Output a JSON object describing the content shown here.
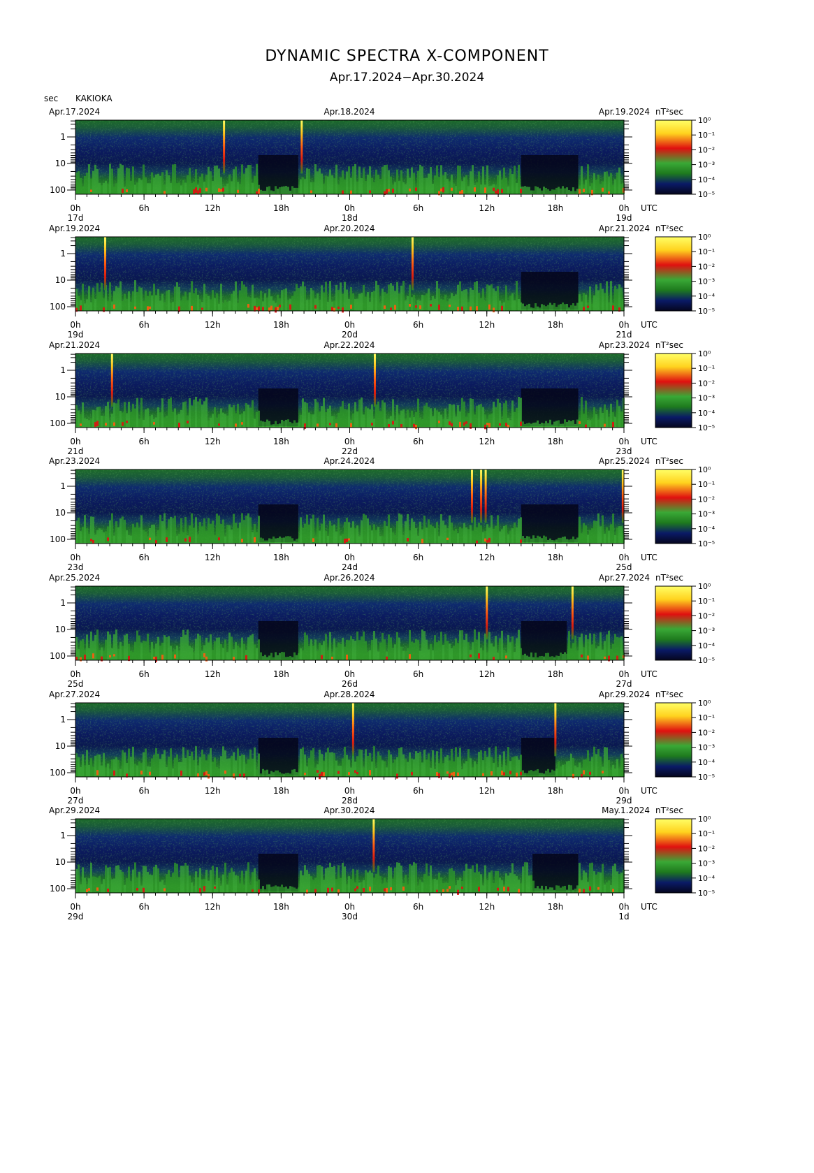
{
  "title": "DYNAMIC SPECTRA X-COMPONENT",
  "subtitle": "Apr.17.2024−Apr.30.2024",
  "period_label": "sec",
  "station": "KAKIOKA",
  "colors": {
    "scale": [
      "#05061e",
      "#0a1a66",
      "#1e7a1e",
      "#3aa836",
      "#e01010",
      "#ff5a10",
      "#ffd21e",
      "#ffff66"
    ]
  },
  "chart_data": {
    "type": "heatmap",
    "y_label": "sec",
    "y_scale": "log",
    "y_ticks": [
      "1",
      "10",
      "100"
    ],
    "x_ticks": [
      "0h",
      "6h",
      "12h",
      "18h",
      "0h",
      "6h",
      "12h",
      "18h",
      "0h"
    ],
    "x_unit": "UTC",
    "colorbar": {
      "unit": "nT²sec",
      "scale": "log",
      "ticks": [
        "10⁰",
        "10⁻¹",
        "10⁻²",
        "10⁻³",
        "10⁻⁴",
        "10⁻⁵"
      ]
    },
    "panels": [
      {
        "start_label": "Apr.17.2024",
        "mid_label": "Apr.18.2024",
        "end_label": "Apr.19.2024",
        "day_labels": [
          "17d",
          "18d",
          "19d"
        ],
        "spikes_hours": [
          13,
          19.8
        ],
        "quiet_hours": [
          [
            16,
            19.5
          ],
          [
            39,
            44
          ]
        ]
      },
      {
        "start_label": "Apr.19.2024",
        "mid_label": "Apr.20.2024",
        "end_label": "Apr.21.2024",
        "day_labels": [
          "19d",
          "20d",
          "21d"
        ],
        "spikes_hours": [
          2.6,
          29.5
        ],
        "quiet_hours": [
          [
            39,
            44
          ]
        ]
      },
      {
        "start_label": "Apr.21.2024",
        "mid_label": "Apr.22.2024",
        "end_label": "Apr.23.2024",
        "day_labels": [
          "21d",
          "22d",
          "23d"
        ],
        "spikes_hours": [
          3.2,
          26.2
        ],
        "quiet_hours": [
          [
            16,
            19.5
          ],
          [
            39,
            44
          ]
        ]
      },
      {
        "start_label": "Apr.23.2024",
        "mid_label": "Apr.24.2024",
        "end_label": "Apr.25.2024",
        "day_labels": [
          "23d",
          "24d",
          "25d"
        ],
        "spikes_hours": [
          34.7,
          35.5,
          35.9,
          47.9
        ],
        "quiet_hours": [
          [
            16,
            19.5
          ],
          [
            39,
            44
          ]
        ]
      },
      {
        "start_label": "Apr.25.2024",
        "mid_label": "Apr.26.2024",
        "end_label": "Apr.27.2024",
        "day_labels": [
          "25d",
          "26d",
          "27d"
        ],
        "spikes_hours": [
          36,
          43.5
        ],
        "quiet_hours": [
          [
            16,
            19.5
          ],
          [
            39,
            43
          ]
        ]
      },
      {
        "start_label": "Apr.27.2024",
        "mid_label": "Apr.28.2024",
        "end_label": "Apr.29.2024",
        "day_labels": [
          "27d",
          "28d",
          "29d"
        ],
        "spikes_hours": [
          24.3,
          42
        ],
        "quiet_hours": [
          [
            16,
            19.5
          ],
          [
            39,
            42
          ]
        ]
      },
      {
        "start_label": "Apr.29.2024",
        "mid_label": "Apr.30.2024",
        "end_label": "May.1.2024",
        "day_labels": [
          "29d",
          "30d",
          "1d"
        ],
        "spikes_hours": [
          26.1
        ],
        "quiet_hours": [
          [
            16,
            19.5
          ],
          [
            40,
            44
          ]
        ]
      }
    ]
  }
}
